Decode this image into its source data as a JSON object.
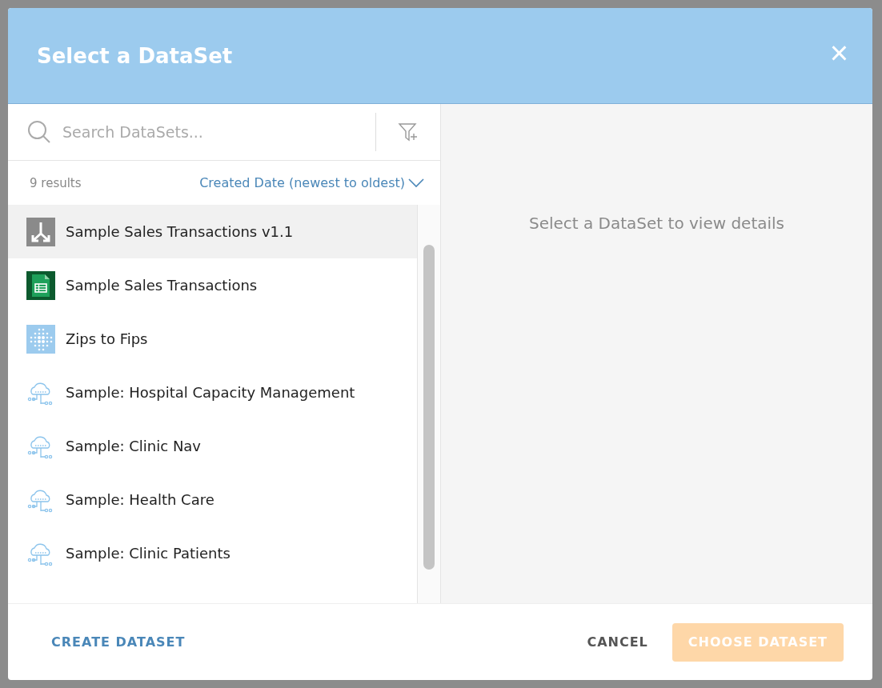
{
  "dialog": {
    "title": "Select a DataSet",
    "close": "×"
  },
  "search": {
    "placeholder": "Search DataSets..."
  },
  "results": {
    "count": "9 results",
    "sort": "Created Date (newest to oldest)"
  },
  "datasets": [
    {
      "name": "Sample Sales Transactions v1.1",
      "kind": "dataflow",
      "selected": true
    },
    {
      "name": "Sample Sales Transactions",
      "kind": "sheet",
      "selected": false
    },
    {
      "name": "Zips to Fips",
      "kind": "dots",
      "selected": false
    },
    {
      "name": "Sample: Hospital Capacity Management",
      "kind": "cloud",
      "selected": false
    },
    {
      "name": "Sample: Clinic Nav",
      "kind": "cloud",
      "selected": false
    },
    {
      "name": "Sample: Health Care",
      "kind": "cloud",
      "selected": false
    },
    {
      "name": "Sample: Clinic Patients",
      "kind": "cloud",
      "selected": false
    }
  ],
  "details": {
    "empty_message": "Select a DataSet to view details"
  },
  "footer": {
    "create": "CREATE DATASET",
    "cancel": "CANCEL",
    "choose": {
      "label": "CHOOSE DATASET",
      "disabled": true
    }
  }
}
